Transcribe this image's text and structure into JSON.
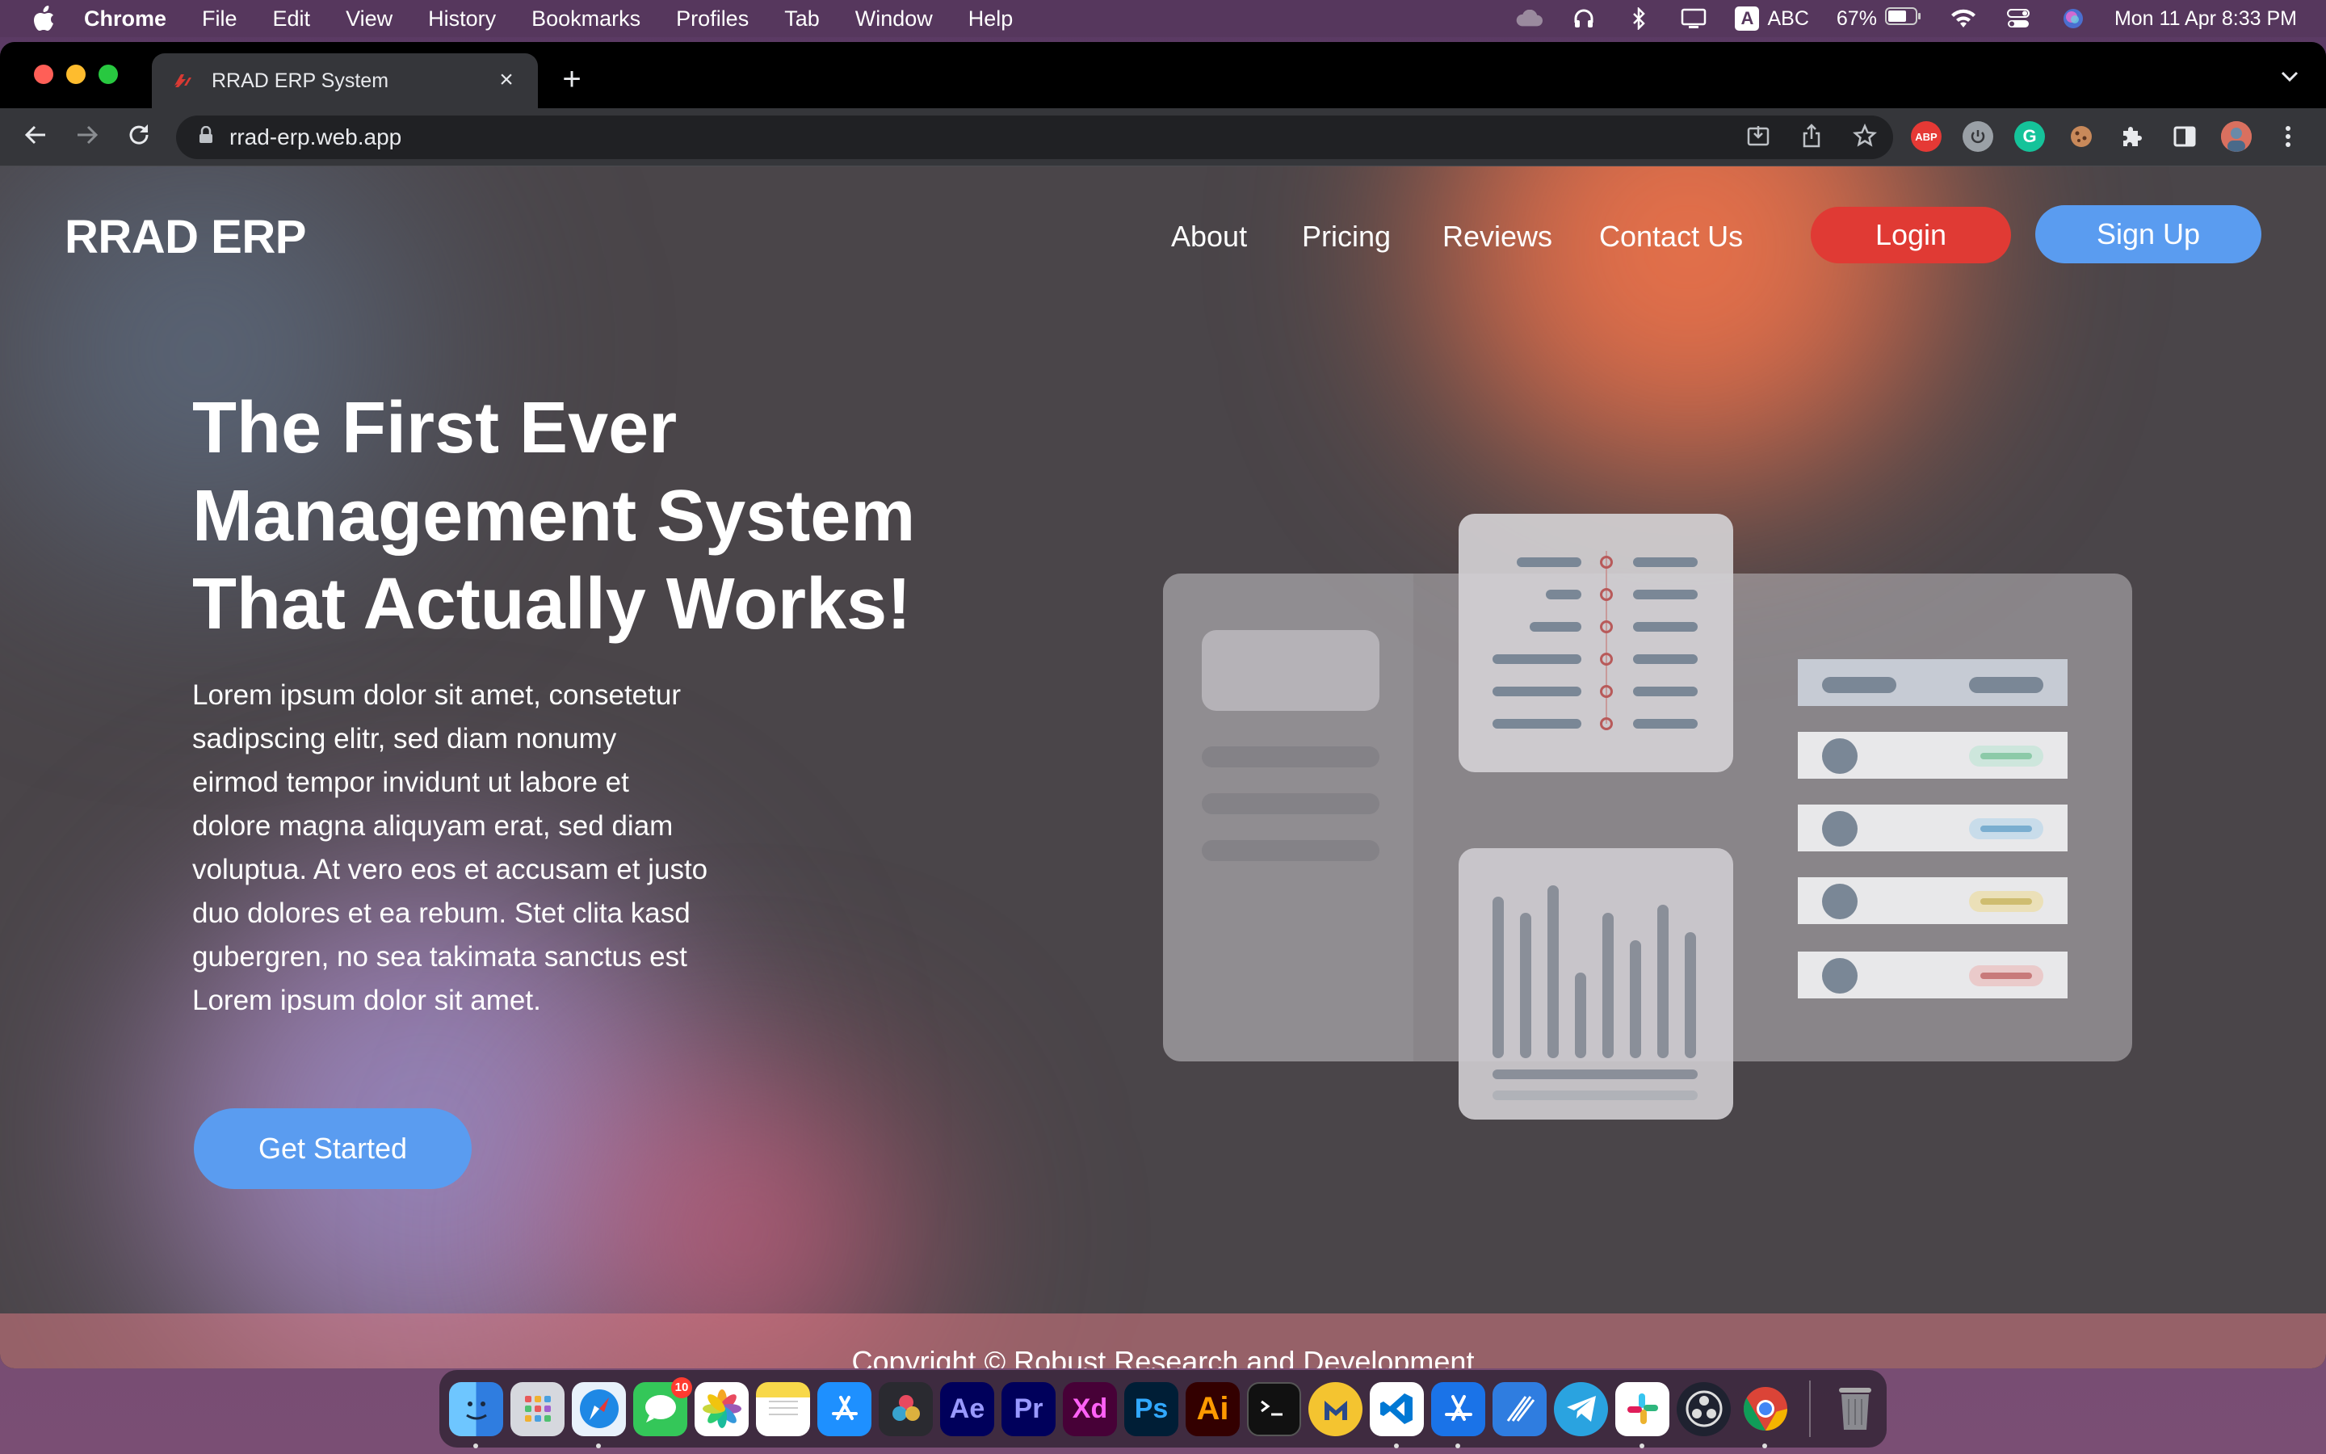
{
  "menubar": {
    "app": "Chrome",
    "items": [
      "File",
      "Edit",
      "View",
      "History",
      "Bookmarks",
      "Profiles",
      "Tab",
      "Window",
      "Help"
    ],
    "input_source": "ABC",
    "battery": "67%",
    "datetime": "Mon 11 Apr  8:33 PM"
  },
  "browser": {
    "tab_title": "RRAD ERP System",
    "url": "rrad-erp.web.app",
    "new_tab": "+",
    "close_tab": "×"
  },
  "site": {
    "brand": "RRAD ERP",
    "nav": [
      "About",
      "Pricing",
      "Reviews",
      "Contact Us"
    ],
    "login": "Login",
    "signup": "Sign Up",
    "hero": {
      "title_lines": [
        "The First Ever",
        "Management System",
        "That Actually Works!"
      ],
      "body": "Lorem ipsum dolor sit amet, consetetur sadipscing elitr, sed diam nonumy eirmod tempor invidunt ut labore et dolore magna aliquyam erat, sed diam voluptua. At vero eos et accusam et justo duo dolores et ea rebum. Stet clita kasd gubergren, no sea takimata sanctus est Lorem ipsum dolor sit amet.",
      "cta": "Get Started"
    },
    "footer": "Copyright © Robust Research and Development"
  },
  "dock": {
    "apps": [
      "Finder",
      "Launchpad",
      "Safari",
      "Messages",
      "Photos",
      "Notes",
      "App Store",
      "DaVinci Resolve",
      "After Effects",
      "Premiere Pro",
      "Adobe XD",
      "Photoshop",
      "Illustrator",
      "Terminal",
      "Mimestream",
      "VS Code",
      "Xcode",
      "Instruments",
      "Telegram",
      "Slack",
      "OBS",
      "Chrome",
      "Trash"
    ],
    "labels": {
      "ae": "Ae",
      "pr": "Pr",
      "xd": "Xd",
      "ps": "Ps",
      "ai": "Ai"
    },
    "messages_badge": "10"
  },
  "colors": {
    "login": "#e03a34",
    "signup": "#5a9cf0",
    "menubar": "#56375d"
  }
}
